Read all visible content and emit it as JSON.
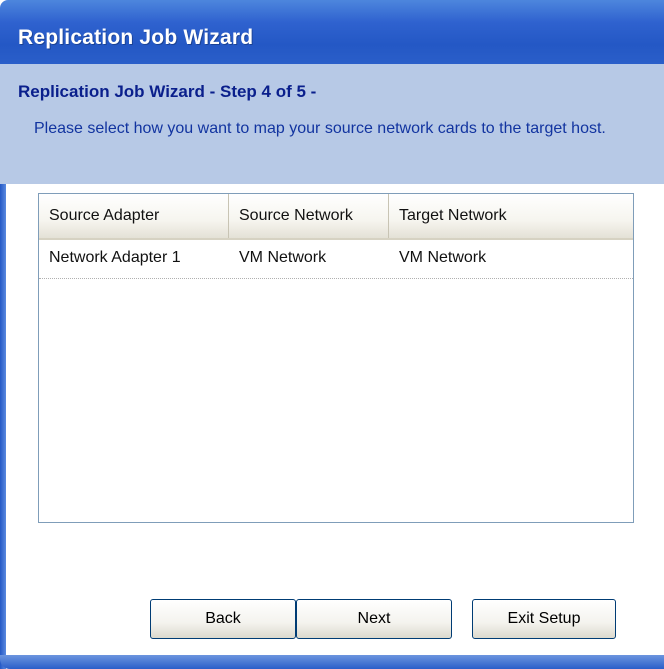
{
  "window": {
    "title": "Replication Job Wizard"
  },
  "header": {
    "step_title": "Replication Job Wizard - Step 4 of 5 -",
    "description": "Please select how you want to map your source network cards to the target host."
  },
  "table": {
    "columns": [
      "Source Adapter",
      "Source Network",
      "Target Network"
    ],
    "rows": [
      [
        "Network Adapter 1",
        "VM Network",
        "VM Network"
      ]
    ]
  },
  "buttons": {
    "back": "Back",
    "next": "Next",
    "exit": "Exit Setup"
  },
  "colors": {
    "title_bar": "#2458c5",
    "header_panel": "#b7c9e6",
    "step_title_text": "#0a1f8c",
    "description_text": "#1234a0"
  }
}
